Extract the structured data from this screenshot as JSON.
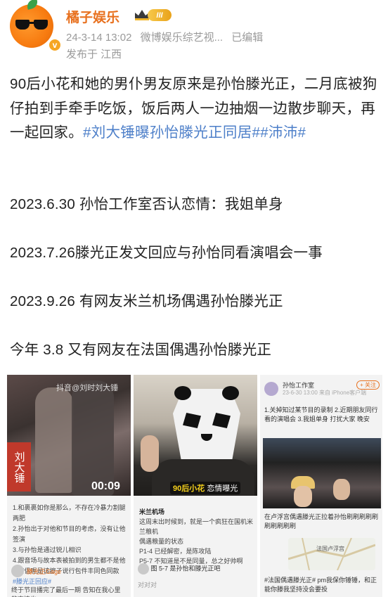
{
  "header": {
    "user_name": "橘子娱乐",
    "vip_level": "III",
    "verified_mark": "v",
    "timestamp": "24-3-14 13:02",
    "source": "微博娱乐综艺视...",
    "edited": "已编辑",
    "location_label": "发布于 江西"
  },
  "post": {
    "text_main": "90后小花和她的男仆男友原来是孙怡滕光正，二月底被狗仔拍到手牵手吃饭，饭后两人一边抽烟一边散步聊天，再一起回家。",
    "hashtag1": "#刘大锤曝孙怡滕光正同居#",
    "hashtag2": "#沛沛#",
    "timeline": [
      "2023.6.30 孙怡工作室否认恋情：我姐单身",
      "2023.7.26滕光正发文回应与孙怡同看演唱会一事",
      "2023.9.26 有网友米兰机场偶遇孙怡滕光正",
      "今年 3.8 又有网友在法国偶遇孙怡滕光正"
    ]
  },
  "images": {
    "img1": {
      "watermark": "抖音@刘时刘大锤",
      "sign": "刘大锤",
      "duration": "00:09",
      "lines": [
        "1.和裹裹如你是那么，不存在冷暴力割腿两肥",
        "2.孙怡出于对他和节目的考虑，没有让他签演",
        "3.与孙怡是通过锐儿相识",
        "4.跟音场与故本表被拍到的男生都不是他",
        "5.情侣喔是该擦子说行包件丰同色同款"
      ],
      "hashtag": "#滕光正回应#",
      "reply_name": "滕光正Gage",
      "reply_text": "终于节目播完了最后一期 告知在我心里的事情也"
    },
    "img2": {
      "caption_hl": "90后小花",
      "caption_rest": "恋情曝光",
      "title": "米兰机场",
      "lines": [
        "这周末出时候到，就是一个疯狂在国机米兰粮机",
        "偶遇粮量的状态",
        "P1-4 已经解密，是陈攻陆",
        "P5-7 不知道是不是同量，总之好帅啊"
      ],
      "reply1": "图 5-7 是孙怡和滕光正吧",
      "reply2": "对对对"
    },
    "img3": {
      "account": "孙怡工作室",
      "time": "23-6-30 13:00 来自 iPhone客户端",
      "follow": "+ 关注",
      "text": "1.关掉知过某节目的录制 2.近期朋友同行看的演唱会 3.我姐单身 打扰大家 晚安",
      "mid_text": "在卢浮宫偶遇滕光正拉着孙怡刷刷刷刷刷刷刷刷刷刷",
      "map_label": "法国卢浮宫",
      "bottom_text": "#法国偶遇滕光正# pm我保你锤锤，和正能你滕我坚持没会要投"
    },
    "colors": {
      "accent_orange": "#e8711f",
      "hashtag_blue": "#4d7fc9",
      "meta_gray": "#9a9a9a"
    }
  }
}
